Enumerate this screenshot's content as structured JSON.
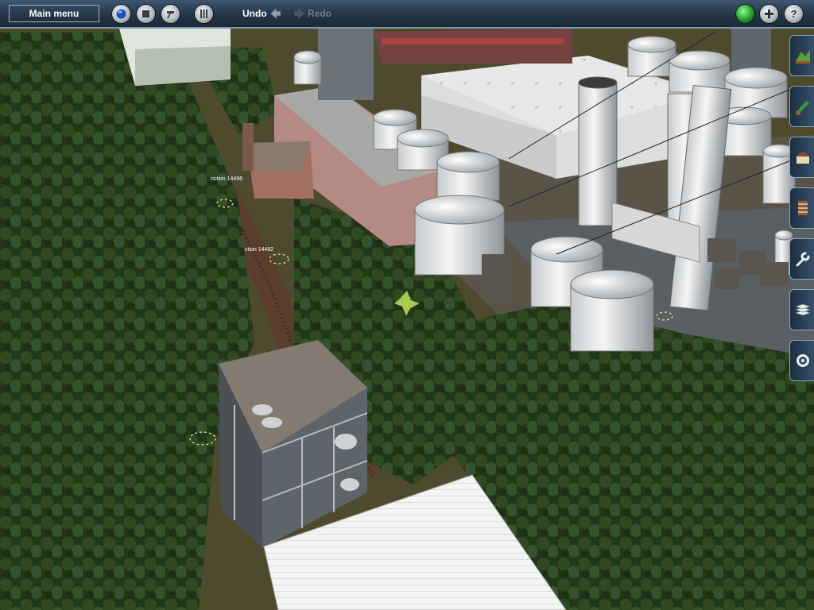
{
  "toolbar": {
    "main_menu_label": "Main menu",
    "undo_label": "Undo",
    "redo_label": "Redo"
  },
  "icons": {
    "left_buttons": [
      "globe-icon",
      "stop-icon",
      "tag-icon",
      "grid-icon"
    ],
    "right_buttons": [
      "green-status-icon",
      "plus-icon",
      "help-icon"
    ],
    "palette_tabs": [
      "terrain-icon",
      "paint-icon",
      "objects-icon",
      "track-icon",
      "tools-icon",
      "layers-icon",
      "settings-icon"
    ]
  },
  "scene": {
    "labels": [
      "nction 14496",
      "ction 14482"
    ]
  },
  "colors": {
    "toolbar_bg": "#243646",
    "toolbar_border": "#7f98ad",
    "status_green": "#1f9a2a",
    "redo_disabled": "#6d7e8d"
  }
}
